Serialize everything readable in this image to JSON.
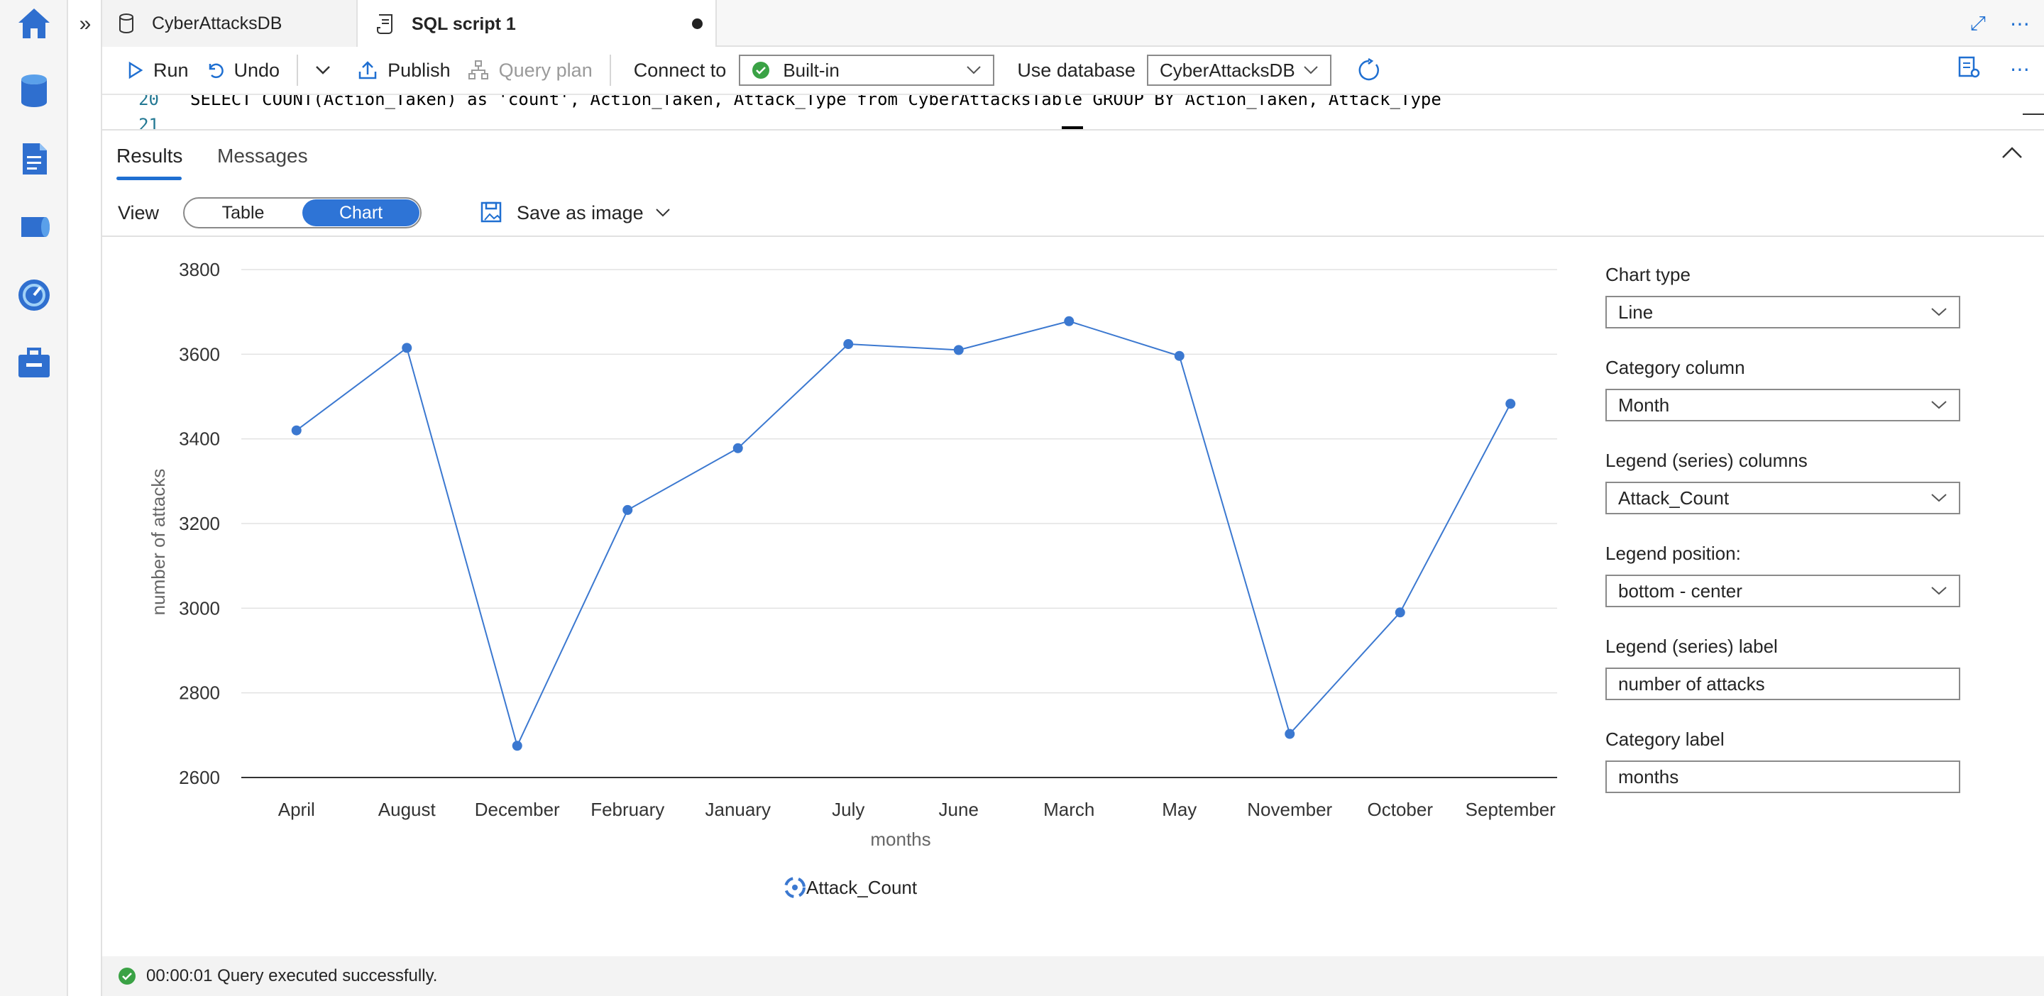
{
  "tabs": [
    {
      "label": "CyberAttacksDB"
    },
    {
      "label": "SQL script 1"
    }
  ],
  "toolbar": {
    "run": "Run",
    "undo": "Undo",
    "publish": "Publish",
    "query_plan": "Query plan",
    "connect_to_label": "Connect to",
    "connect_to_value": "Built-in",
    "use_database_label": "Use database",
    "use_database_value": "CyberAttacksDB"
  },
  "editor": {
    "lines": [
      {
        "number": "20",
        "text": "SELECT COUNT(Action_Taken) as 'count', Action_Taken, Attack_Type from CyberAttacksTable GROUP BY Action_Taken, Attack_Type"
      },
      {
        "number": "21",
        "text": ""
      }
    ]
  },
  "results": {
    "tabs": [
      "Results",
      "Messages"
    ],
    "view_label": "View",
    "view_options": [
      "Table",
      "Chart"
    ],
    "view_selected": "Chart",
    "save_as_image": "Save as image"
  },
  "chart_data": {
    "type": "line",
    "categories": [
      "April",
      "August",
      "December",
      "February",
      "January",
      "July",
      "June",
      "March",
      "May",
      "November",
      "October",
      "September"
    ],
    "series": [
      {
        "name": "Attack_Count",
        "values": [
          3420,
          3615,
          2675,
          3232,
          3378,
          3624,
          3610,
          3678,
          3596,
          2703,
          2990,
          3483
        ]
      }
    ],
    "ylim": [
      2600,
      3800
    ],
    "yticks": [
      3800,
      3600,
      3400,
      3200,
      3000,
      2800,
      2600
    ],
    "xlabel": "months",
    "ylabel": "number of attacks",
    "legend_position": "bottom-center",
    "grid": true,
    "color": "#3b78d0"
  },
  "settings": {
    "chart_type_label": "Chart type",
    "chart_type_value": "Line",
    "category_column_label": "Category column",
    "category_column_value": "Month",
    "legend_columns_label": "Legend (series) columns",
    "legend_columns_value": "Attack_Count",
    "legend_position_label": "Legend position:",
    "legend_position_value": "bottom - center",
    "legend_label_label": "Legend (series) label",
    "legend_label_value": "number of attacks",
    "category_label_label": "Category label",
    "category_label_value": "months"
  },
  "status": {
    "text": "00:00:01 Query executed successfully."
  },
  "colors": {
    "accent": "#1f6fd1",
    "toggle_on": "#2e74d6",
    "success": "#3aa245"
  }
}
